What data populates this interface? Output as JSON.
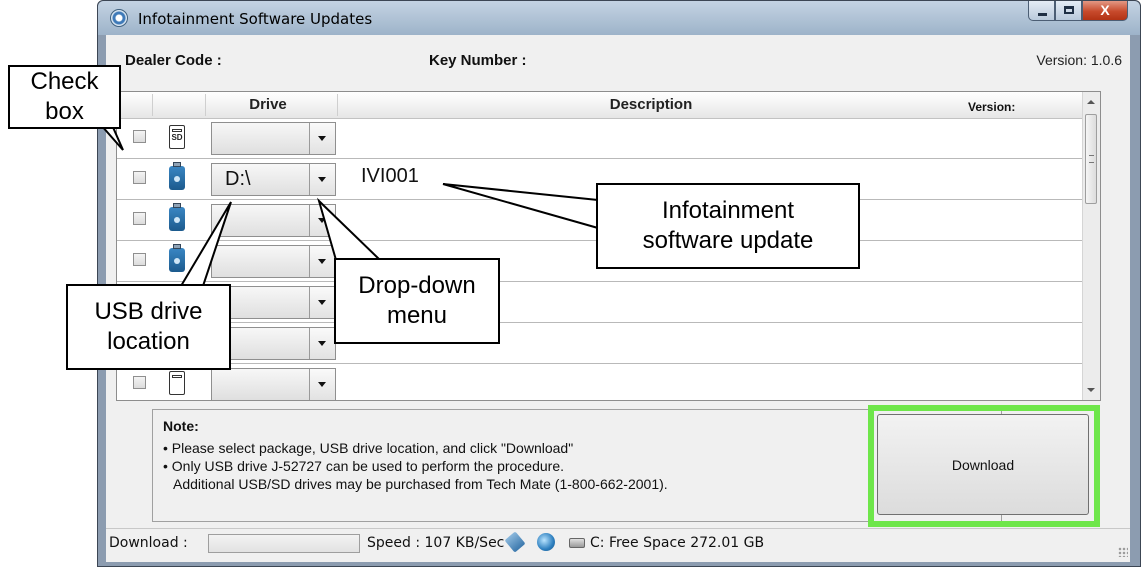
{
  "window": {
    "title": "Infotainment Software Updates",
    "controls": {
      "minimize": "minimize",
      "maximize": "maximize",
      "close": "X"
    }
  },
  "info": {
    "dealer_code": "Dealer Code :",
    "key_number": "Key Number :",
    "version": "Version: 1.0.6"
  },
  "grid": {
    "columns": {
      "drive": "Drive",
      "description": "Description",
      "version": "Version:"
    },
    "rows": [
      {
        "device": "sd",
        "device_icon": "sd-card-icon",
        "sd_text": "SD",
        "drive": "",
        "description": ""
      },
      {
        "device": "usb",
        "device_icon": "usb-drive-icon",
        "drive": "D:\\",
        "description": "IVI001"
      },
      {
        "device": "usb",
        "device_icon": "usb-drive-icon",
        "drive": "",
        "description": ""
      },
      {
        "device": "usb",
        "device_icon": "usb-drive-icon",
        "drive": "",
        "description": ""
      },
      {
        "device": "usb",
        "device_icon": "usb-drive-icon",
        "drive": "",
        "description": ""
      },
      {
        "device": "usb",
        "device_icon": "usb-drive-icon",
        "drive": "",
        "description": ""
      },
      {
        "device": "sd",
        "device_icon": "sd-card-icon",
        "drive": "",
        "description": ""
      }
    ]
  },
  "note": {
    "title": "Note:",
    "lines": [
      "• Please select package, USB drive location, and click \"Download\"",
      "• Only USB drive J-52727 can be used to perform the procedure.",
      "Additional USB/SD drives may be purchased from Tech Mate (1-800-662-2001)."
    ]
  },
  "download_button": {
    "label": "Download"
  },
  "highlight_color": "#6ee64a",
  "status": {
    "download_label": "Download :",
    "download_progress": 0,
    "speed": "Speed : 107 KB/Sec",
    "free_space": "C: Free Space 272.01 GB",
    "icons": [
      "usb-transfer-icon",
      "network-globe-icon",
      "hard-drive-icon"
    ]
  },
  "callouts": {
    "check_box": [
      "Check",
      "box"
    ],
    "usb_location": [
      "USB drive",
      "location"
    ],
    "drop_down": [
      "Drop-down",
      "menu"
    ],
    "infotainment": [
      "Infotainment",
      "software update"
    ]
  }
}
